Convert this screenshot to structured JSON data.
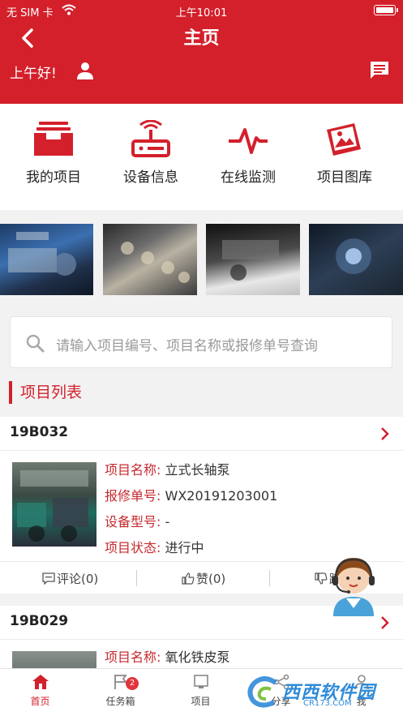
{
  "status_bar": {
    "carrier": "无 SIM 卡",
    "time": "上午10:01"
  },
  "header": {
    "title": "主页",
    "greeting": "上午好!"
  },
  "quick_entries": [
    {
      "label": "我的项目",
      "icon": "inbox-tray-icon"
    },
    {
      "label": "设备信息",
      "icon": "router-device-icon"
    },
    {
      "label": "在线监测",
      "icon": "pulse-line-icon"
    },
    {
      "label": "项目图库",
      "icon": "photo-gallery-icon"
    }
  ],
  "search": {
    "placeholder": "请输入项目编号、项目名称或报修单号查询"
  },
  "section": {
    "title": "项目列表"
  },
  "projects": [
    {
      "code": "19B032",
      "fields": [
        {
          "key": "项目名称:",
          "value": "立式长轴泵"
        },
        {
          "key": "报修单号:",
          "value": "WX20191203001"
        },
        {
          "key": "设备型号:",
          "value": "-"
        },
        {
          "key": "项目状态:",
          "value": "进行中"
        }
      ],
      "actions": {
        "comment": "评论(0)",
        "like": "赞(0)",
        "dislike": "踩"
      }
    },
    {
      "code": "19B029",
      "fields": [
        {
          "key": "项目名称:",
          "value": "氧化铁皮泵"
        }
      ]
    }
  ],
  "tabbar": {
    "tabs": [
      {
        "label": "首页",
        "active": true
      },
      {
        "label": "任务箱",
        "badge": "2"
      },
      {
        "label": "项目"
      },
      {
        "label": "分享"
      },
      {
        "label": "我"
      }
    ]
  },
  "watermark": {
    "text": "西西软件园",
    "sub": "CR173.COM"
  },
  "colors": {
    "brand": "#d3202b",
    "background": "#f2f2f2"
  }
}
